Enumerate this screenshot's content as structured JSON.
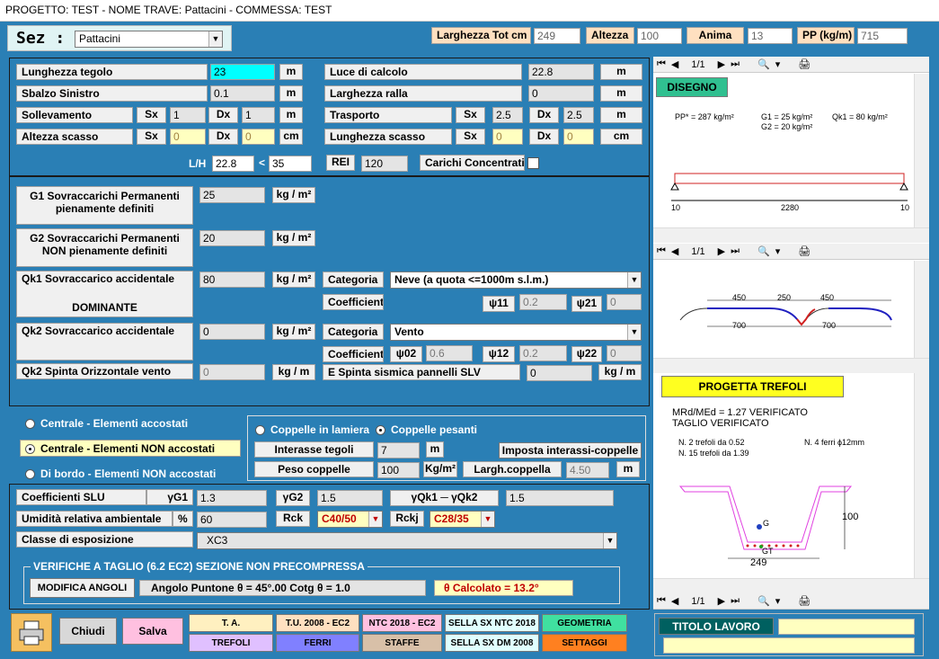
{
  "title": "PROGETTO: TEST - NOME TRAVE: Pattacini - COMMESSA: TEST",
  "sez": {
    "label": "Sez :",
    "value": "Pattacini"
  },
  "header": {
    "larghezza_label": "Larghezza Tot  cm",
    "larghezza_val": "249",
    "altezza_label": "Altezza",
    "altezza_val": "100",
    "anima_label": "Anima",
    "anima_val": "13",
    "pp_label": "PP (kg/m)",
    "pp_val": "715"
  },
  "geo": {
    "lunghezza_label": "Lunghezza tegolo",
    "lunghezza_val": "23",
    "m": "m",
    "sbalzo_label": "Sbalzo Sinistro",
    "sbalzo_val": "0.1",
    "soll_label": "Sollevamento",
    "sx": "Sx",
    "dx": "Dx",
    "soll_sx": "1",
    "soll_dx": "1",
    "scasso_label": "Altezza  scasso",
    "scasso_sx": "0",
    "scasso_dx": "0",
    "cm": "cm",
    "luce_label": "Luce di calcolo",
    "luce_val": "22.8",
    "ralla_label": "Larghezza ralla",
    "ralla_val": "0",
    "trasporto_label": "Trasporto",
    "tr_sx": "2.5",
    "tr_dx": "2.5",
    "lscasso_label": "Lunghezza scasso",
    "ls_sx": "0",
    "ls_dx": "0",
    "lh_label": "L/H",
    "lh_val": "22.8",
    "lt": "<",
    "lh_max": "35",
    "rei_label": "REI",
    "rei_val": "120",
    "carichi_label": "Carichi Concentrati"
  },
  "loads": {
    "g1_label": "G1   Sovraccarichi Permanenti\npienamente definiti",
    "g1_val": "25",
    "kgm2": "kg / m²",
    "g2_label": "G2   Sovraccarichi Permanenti\nNON pienamente definiti",
    "g2_val": "20",
    "qk1_label": "Qk1 Sovraccarico accidentale",
    "qk1_dom": "DOMINANTE",
    "qk1_val": "80",
    "categoria": "Categoria",
    "cat1_val": "Neve (a quota <=1000m s.l.m.)",
    "coeff": "Coefficienti",
    "psi11": "ψ11",
    "psi11_val": "0.2",
    "psi21": "ψ21",
    "psi21_val": "0",
    "qk2_label": "Qk2  Sovraccarico accidentale",
    "qk2_val": "0",
    "cat2_val": "Vento",
    "psi02": "ψ02",
    "psi02_val": "0.6",
    "psi12": "ψ12",
    "psi12_val": "0.2",
    "psi22": "ψ22",
    "psi22_val": "0",
    "vento_label": "Qk2      Spinta Orizzontale vento",
    "vento_val": "0",
    "kgm": "kg / m",
    "sisma_label": "E Spinta sismica pannelli  SLV",
    "sisma_val": "0"
  },
  "layout": {
    "r1": "Centrale - Elementi accostati",
    "r2": "Centrale  - Elementi NON accostati",
    "r3": "Di bordo - Elementi NON accostati",
    "c1": "Coppelle in lamiera",
    "c2": "Coppelle pesanti",
    "interasse_label": "Interasse tegoli",
    "interasse_val": "7",
    "imposta_btn": "Imposta interassi-coppelle",
    "peso_label": "Peso coppelle",
    "peso_val": "100",
    "peso_unit": "Kg/m²",
    "largh_label": "Largh.coppella",
    "largh_val": "4.50",
    "m": "m"
  },
  "slu": {
    "coeff_label": "Coefficienti SLU",
    "g1": "γG1",
    "g1_val": "1.3",
    "g2": "γG2",
    "g2_val": "1.5",
    "qk": "γQk1  ─  γQk2",
    "qk_val": "1.5",
    "umid_label": "Umidità relativa ambientale",
    "pct": "%",
    "umid_val": "60",
    "rck": "Rck",
    "rck_val": "C40/50",
    "rckj": "Rckj",
    "rckj_val": "C28/35",
    "classe_label": "Classe di esposizione",
    "classe_val": "XC3"
  },
  "taglio": {
    "title": "VERIFICHE A TAGLIO (6.2 EC2) SEZIONE NON PRECOMPRESSA",
    "modifica": "MODIFICA ANGOLI",
    "angolo": "Angolo Puntone  θ  =  45°.00       Cotg θ = 1.0",
    "calcolato": "θ  Calcolato =  13.2°"
  },
  "bottom": {
    "chiudi": "Chiudi",
    "salva": "Salva",
    "ta": "T. A.",
    "tu": "T.U. 2008 - EC2",
    "ntc": "NTC 2018 - EC2",
    "sella_ntc": "SELLA SX NTC 2018",
    "geometria": "GEOMETRIA",
    "trefoli": "TREFOLI",
    "ferri": "FERRI",
    "staffe": "STAFFE",
    "sella_dm": "SELLA SX DM 2008",
    "settaggi": "SETTAGGI",
    "titolo": "TITOLO LAVORO"
  },
  "right": {
    "page": "1/1",
    "disegno": "DISEGNO",
    "pp_text": "PP* = 287 kg/m²",
    "g1_text": "G1 = 25 kg/m²",
    "g2_text": "G2 = 20 kg/m²",
    "qk1_text": "Qk1 = 80 kg/m²",
    "beam_left": "10",
    "beam_mid": "2280",
    "beam_right": "10",
    "sec_450a": "450",
    "sec_250": "250",
    "sec_450b": "450",
    "sec_700a": "700",
    "sec_700b": "700",
    "progetta": "PROGETTA TREFOLI",
    "res1": "MRd/MEd = 1.27 VERIFICATO",
    "res2": "TAGLIO VERIFICATO",
    "tref1": "N. 2 trefoli da 0.52",
    "tref2": "N. 15 trefoli da 1.39",
    "ferri": "N. 4 ferri  ϕ12mm",
    "dim_h": "100",
    "dim_w": "249",
    "g_label": "G",
    "gt_label": "GT"
  }
}
